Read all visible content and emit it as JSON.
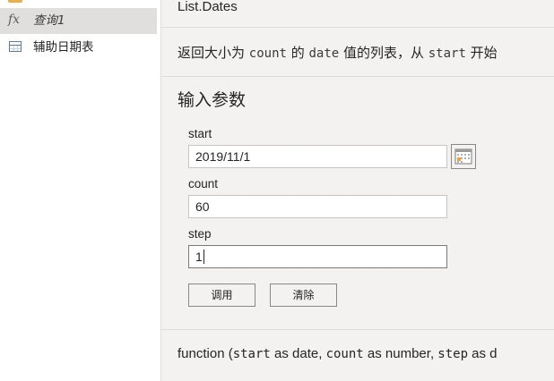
{
  "queries": {
    "items": [
      {
        "label": "",
        "icon": "folder-icon"
      },
      {
        "label": "查询1",
        "icon": "function-icon",
        "icon_text": "fx",
        "selected": true
      },
      {
        "label": "辅助日期表",
        "icon": "table-icon"
      }
    ]
  },
  "function": {
    "name": "List.Dates",
    "description": {
      "part1": "返回大小为 ",
      "code1": "count",
      "part2": " 的 ",
      "code2": "date",
      "part3": " 值的列表，从 ",
      "code3": "start",
      "part4": " 开始"
    },
    "params_title": "输入参数",
    "params": [
      {
        "name": "start",
        "value": "2019/11/1"
      },
      {
        "name": "count",
        "value": "60"
      },
      {
        "name": "step",
        "value": "1"
      }
    ],
    "buttons": {
      "invoke": "调用",
      "clear": "清除"
    },
    "signature": {
      "prefix": "function (",
      "p1": "start",
      "t1": " as date, ",
      "p2": "count",
      "t2": " as number, ",
      "p3": "step",
      "t3": " as d"
    }
  },
  "colors": {
    "selected_bg": "#e1dfdd",
    "pane_bg": "#f3f2f1",
    "table_icon": "#5b7aa7",
    "folder_icon": "#e8b04a"
  }
}
